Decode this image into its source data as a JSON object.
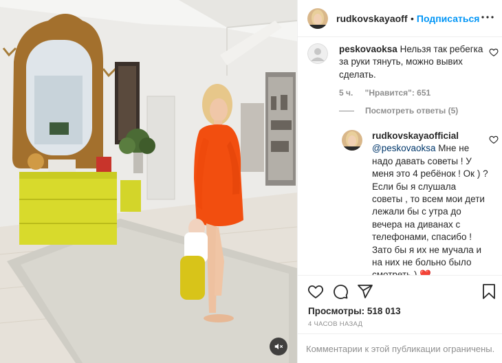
{
  "post": {
    "author": "rudkovskayaofficial",
    "author_truncated": "rudkovskayaoffic",
    "dot": "•",
    "follow_label": "Подписаться"
  },
  "comments": [
    {
      "user": "peskovaoksa",
      "text": "Нельзя так ребегка за руки тянуть, можно вывих сделать.",
      "time": "5 ч.",
      "likes": "\"Нравится\": 651",
      "view_replies": "Посмотреть ответы (5)"
    },
    {
      "user": "rudkovskayaofficial",
      "mention": "@peskovaoksa",
      "text": "Мне не надо давать советы ! У меня это 4 ребёнок ! Ок ) ? Если бы я слушала советы , то всем мои дети лежали бы с утра до вечера на диванах с телефонами, спасибо ! Зато бы я их не мучала и на них не больно было смотреть )",
      "emoji": "❤️"
    }
  ],
  "stats": {
    "views": "Просмотры: 518 013",
    "posted": "4 ЧАСОВ НАЗАД"
  },
  "footer": {
    "comments_disabled": "Комментарии к этой публикации ограничены."
  },
  "icons": {
    "like": "heart-icon",
    "comment": "comment-icon",
    "share": "share-icon",
    "save": "bookmark-icon",
    "more": "more-icon",
    "mute": "speaker-muted-icon"
  },
  "colors": {
    "accent": "#0095f6",
    "muted_text": "#8e8e8e",
    "mention": "#00376b",
    "heart": "#ed4956"
  }
}
